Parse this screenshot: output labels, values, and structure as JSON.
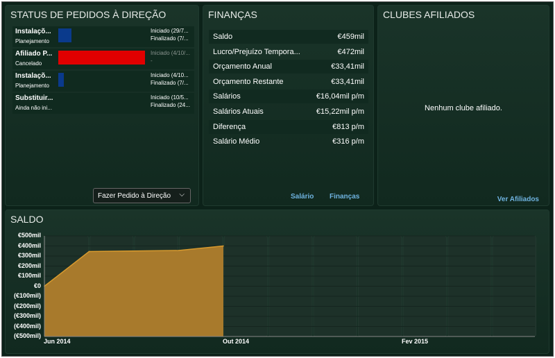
{
  "requests": {
    "title": "STATUS DE PEDIDOS À DIREÇÃO",
    "items": [
      {
        "name": "Instalaçõ...",
        "status": "Planejamento",
        "progress": 0.15,
        "color": "#0a3a8c",
        "d1": "Iniciado (29/7...",
        "d2": "Finalizado (7/..."
      },
      {
        "name": "Afiliado P...",
        "status": "Cancelado",
        "progress": 1.0,
        "color": "#e00000",
        "d1": "Iniciado (4/10/...",
        "d2": "-"
      },
      {
        "name": "Instalaçõ...",
        "status": "Planejamento",
        "progress": 0.06,
        "color": "#0a3a8c",
        "d1": "Iniciado (4/10...",
        "d2": "Finalizado (7/..."
      },
      {
        "name": "Substituir...",
        "status": "Ainda não ini...",
        "progress": 0,
        "color": "#0a3a8c",
        "d1": "Iniciado (10/5...",
        "d2": "Finalizado (24..."
      }
    ],
    "dropdown": "Fazer Pedido à Direção"
  },
  "finance": {
    "title": "FINANÇAS",
    "rows": [
      {
        "k": "Saldo",
        "v": "€459mil"
      },
      {
        "k": "Lucro/Prejuízo Tempora...",
        "v": "€472mil"
      },
      {
        "k": "Orçamento Anual",
        "v": "€33,41mil"
      },
      {
        "k": "Orçamento Restante",
        "v": "€33,41mil"
      },
      {
        "k": "Salários",
        "v": "€16,04mil p/m"
      },
      {
        "k": "Salários Atuais",
        "v": "€15,22mil p/m"
      },
      {
        "k": "Diferença",
        "v": "€813 p/m"
      },
      {
        "k": "Salário Médio",
        "v": "€316 p/m"
      }
    ],
    "link_salary": "Salário",
    "link_finance": "Finanças"
  },
  "clubs": {
    "title": "CLUBES AFILIADOS",
    "empty": "Nenhum clube afiliado.",
    "link": "Ver Afiliados"
  },
  "chart_data": {
    "type": "area",
    "title": "SALDO",
    "color": "#a87a2c",
    "ylim": [
      -500,
      500
    ],
    "yticks": [
      "€500mil",
      "€400mil",
      "€300mil",
      "€200mil",
      "€100mil",
      "€0",
      "(€100mil)",
      "(€200mil)",
      "(€300mil)",
      "(€400mil)",
      "(€500mil)"
    ],
    "xticks": [
      "Jun 2014",
      "Out 2014",
      "Fev 2015"
    ],
    "x": [
      "Jun 2014",
      "Jul 2014",
      "Set 2014",
      "Out 2014"
    ],
    "values": [
      0,
      345,
      355,
      400
    ]
  }
}
